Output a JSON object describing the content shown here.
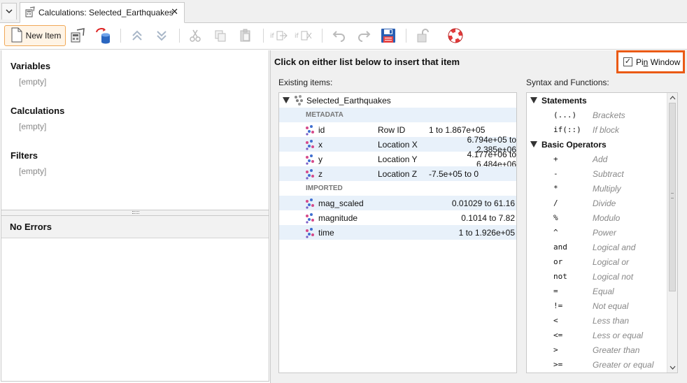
{
  "tab": {
    "title": "Calculations: Selected_Earthquakes",
    "close_glyph": "✕",
    "icon": "calculator-icon"
  },
  "toolbar": {
    "new_item_label": "New Item",
    "icons": [
      "edit-variables-icon",
      "import-database-icon",
      "move-up-icon",
      "move-down-icon",
      "cut-icon",
      "copy-icon",
      "paste-icon",
      "insert-if-icon",
      "remove-if-icon",
      "undo-icon",
      "redo-icon",
      "save-icon",
      "unlock-icon",
      "help-lifebuoy-icon"
    ]
  },
  "left": {
    "sections": [
      {
        "title": "Variables",
        "empty": "[empty]"
      },
      {
        "title": "Calculations",
        "empty": "[empty]"
      },
      {
        "title": "Filters",
        "empty": "[empty]"
      }
    ],
    "errors_title": "No Errors"
  },
  "right": {
    "instruction": "Click on either list below to insert that item",
    "pin_window": {
      "label_before": "Pi",
      "label_underlined": "n",
      "label_after": " Window",
      "checked": true,
      "check_glyph": "✓",
      "highlight_color": "#ea5a15"
    },
    "existing_caption": "Existing items:",
    "syntax_caption": "Syntax and Functions:",
    "existing": {
      "root": "Selected_Earthquakes",
      "groups": [
        {
          "label": "METADATA",
          "items": [
            {
              "name": "id",
              "type": "Row ID",
              "range": "1 to 1.867e+05"
            },
            {
              "name": "x",
              "type": "Location X",
              "range": "6.794e+05 to 2.385e+06"
            },
            {
              "name": "y",
              "type": "Location Y",
              "range": "4.177e+06 to 6.484e+06"
            },
            {
              "name": "z",
              "type": "Location Z",
              "range": "-7.5e+05 to 0"
            }
          ]
        },
        {
          "label": "IMPORTED",
          "items": [
            {
              "name": "mag_scaled",
              "type": "",
              "range": "0.01029 to 61.16"
            },
            {
              "name": "magnitude",
              "type": "",
              "range": "0.1014 to 7.82"
            },
            {
              "name": "time",
              "type": "",
              "range": "1 to 1.926e+05"
            }
          ]
        }
      ]
    },
    "syntax": {
      "statements_title": "Statements",
      "statements": [
        {
          "code": "(...)",
          "desc": "Brackets"
        },
        {
          "code": "if(::)",
          "desc": "If block"
        }
      ],
      "operators_title": "Basic Operators",
      "operators": [
        {
          "code": "+",
          "desc": "Add"
        },
        {
          "code": "-",
          "desc": "Subtract"
        },
        {
          "code": "*",
          "desc": "Multiply"
        },
        {
          "code": "/",
          "desc": "Divide"
        },
        {
          "code": "%",
          "desc": "Modulo"
        },
        {
          "code": "^",
          "desc": "Power"
        },
        {
          "code": "and",
          "desc": "Logical and"
        },
        {
          "code": "or",
          "desc": "Logical or"
        },
        {
          "code": "not",
          "desc": "Logical not"
        },
        {
          "code": "=",
          "desc": "Equal"
        },
        {
          "code": "!=",
          "desc": "Not equal"
        },
        {
          "code": "<",
          "desc": "Less than"
        },
        {
          "code": "<=",
          "desc": "Less or equal"
        },
        {
          "code": ">",
          "desc": "Greater than"
        },
        {
          "code": ">=",
          "desc": "Greater or equal"
        }
      ]
    }
  }
}
